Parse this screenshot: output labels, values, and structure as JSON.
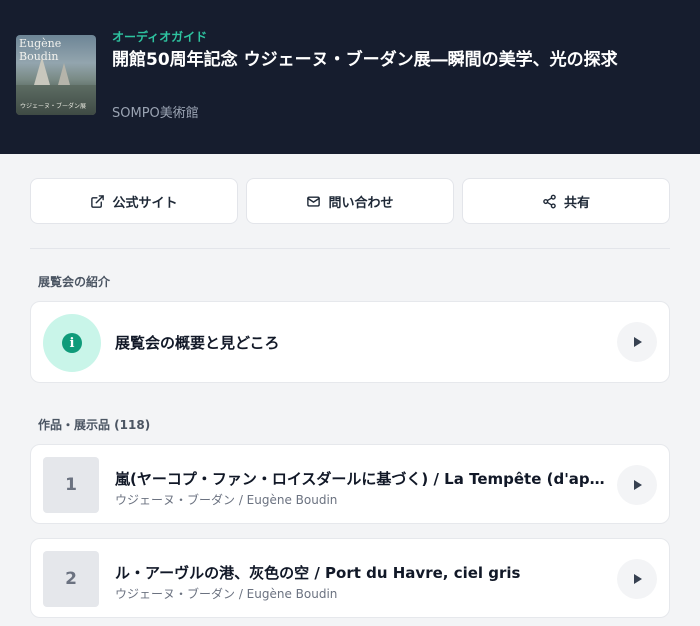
{
  "header": {
    "guide_label": "オーディオガイド",
    "title": "開館50周年記念 ウジェーヌ・ブーダン展―瞬間の美学、光の探求",
    "venue": "SOMPO美術館",
    "cover": {
      "title": "Eugène Boudin",
      "subtitle": "ウジェーヌ・ブーダン展"
    }
  },
  "actions": [
    {
      "label": "公式サイト",
      "icon": "external-link-icon"
    },
    {
      "label": "問い合わせ",
      "icon": "mail-icon"
    },
    {
      "label": "共有",
      "icon": "share-icon"
    }
  ],
  "intro_section": {
    "heading": "展覧会の紹介",
    "card_label": "展覧会の概要と見どころ",
    "icon": "info-icon"
  },
  "works_section": {
    "heading": "作品・展示品 (118)",
    "items": [
      {
        "number": "1",
        "title": "嵐(ヤーコプ・ファン・ロイスダールに基づく) / La Tempête (d'après Jacob van Ruisdael)",
        "artist": "ウジェーヌ・ブーダン / Eugène Boudin"
      },
      {
        "number": "2",
        "title": "ル・アーヴルの港、灰色の空 / Port du Havre, ciel gris",
        "artist": "ウジェーヌ・ブーダン / Eugène Boudin"
      }
    ]
  },
  "colors": {
    "header_bg": "#161d2e",
    "accent": "#2ec4a0",
    "info_icon": "#0f9b7a"
  }
}
